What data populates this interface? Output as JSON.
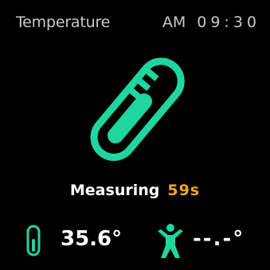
{
  "header": {
    "title": "Temperature",
    "am_pm": "AM",
    "time": "09:30"
  },
  "status": {
    "label": "Measuring",
    "countdown": "59s"
  },
  "readings": {
    "object_temperature": "35.6°",
    "body_temperature": "--.-°"
  },
  "icons": {
    "main": "thermometer-icon",
    "object": "small-thermometer-icon",
    "body": "human-body-icon"
  },
  "colors": {
    "accent": "#1fd6a0",
    "countdown": "#f5a623",
    "text": "#ffffff",
    "header_text": "#c9c9c9",
    "background": "#000000"
  }
}
